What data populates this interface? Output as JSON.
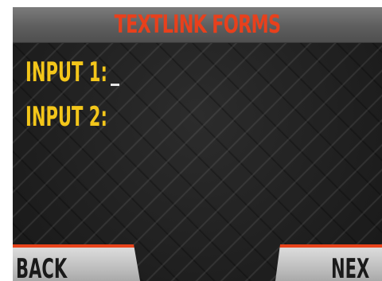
{
  "title": "TEXTLINK FORMS",
  "fields": [
    {
      "label": "INPUT 1:",
      "value": ""
    },
    {
      "label": "INPUT 2:",
      "value": ""
    }
  ],
  "buttons": {
    "back_label": "BACK",
    "next_label": "NEX"
  },
  "colors": {
    "title": "#e8401c",
    "label": "#f3c61a",
    "accent": "#e8431b",
    "button_face": "#c8c8c8",
    "background": "#1e1e1e"
  }
}
